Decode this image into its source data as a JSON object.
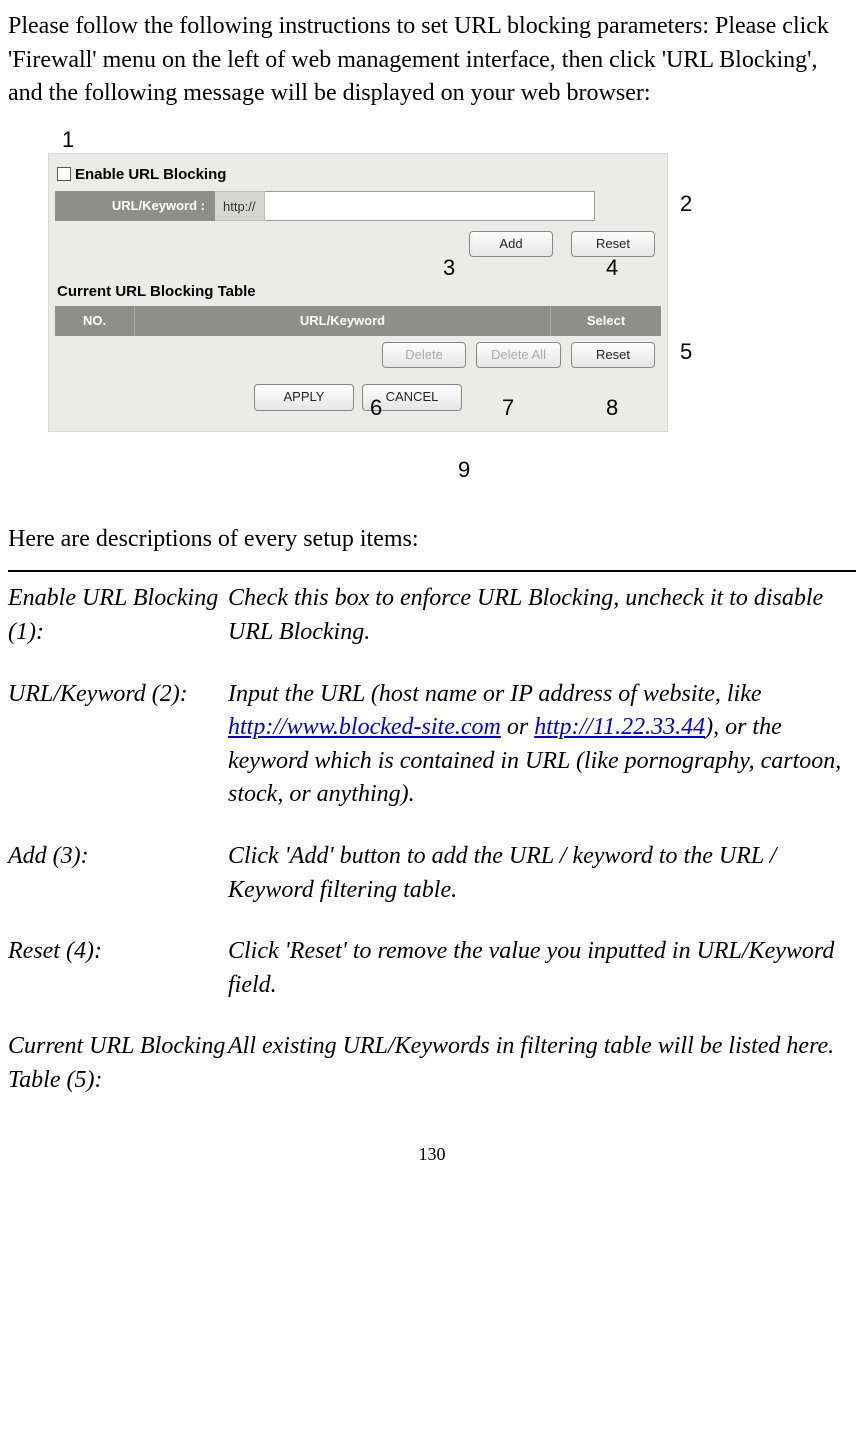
{
  "intro": "Please follow the following instructions to set URL blocking parameters: Please click 'Firewall' menu on the left of web management interface, then click 'URL Blocking', and the following message will be displayed on your web browser:",
  "screenshot": {
    "enable_label": "Enable URL Blocking",
    "url_label": "URL/Keyword :",
    "http_prefix": "http://",
    "url_value": "",
    "add_btn": "Add",
    "reset_btn": "Reset",
    "table_title": "Current URL Blocking Table",
    "th_no": "NO.",
    "th_kw": "URL/Keyword",
    "th_sel": "Select",
    "delete_btn": "Delete",
    "delete_all_btn": "Delete All",
    "reset2_btn": "Reset",
    "apply_btn": "APPLY",
    "cancel_btn": "CANCEL"
  },
  "callouts": {
    "c1": "1",
    "c2": "2",
    "c3": "3",
    "c4": "4",
    "c5": "5",
    "c6": "6",
    "c7": "7",
    "c8": "8",
    "c9": "9"
  },
  "heredesc": "Here are descriptions of every setup items:",
  "defs": [
    {
      "term": "Enable URL Blocking (1):",
      "body": "Check this box to enforce URL Blocking, uncheck it to disable URL Blocking."
    },
    {
      "term": "URL/Keyword (2):",
      "body_pre": "Input the URL (host name or IP address of website, like ",
      "link1": "http://www.blocked-site.com",
      "body_mid": " or ",
      "link2": "http://11.22.33.44",
      "body_post": "), or the keyword which is contained in URL (like pornography, cartoon, stock, or anything)."
    },
    {
      "term": "Add (3):",
      "body": "Click 'Add' button to add the URL / keyword to the URL / Keyword filtering table."
    },
    {
      "term": "Reset (4):",
      "body": "Click 'Reset' to remove the value you inputted in URL/Keyword field."
    },
    {
      "term": "Current URL Blocking Table (5):",
      "body": "All existing URL/Keywords in filtering table will be listed here."
    }
  ],
  "pagenum": "130"
}
